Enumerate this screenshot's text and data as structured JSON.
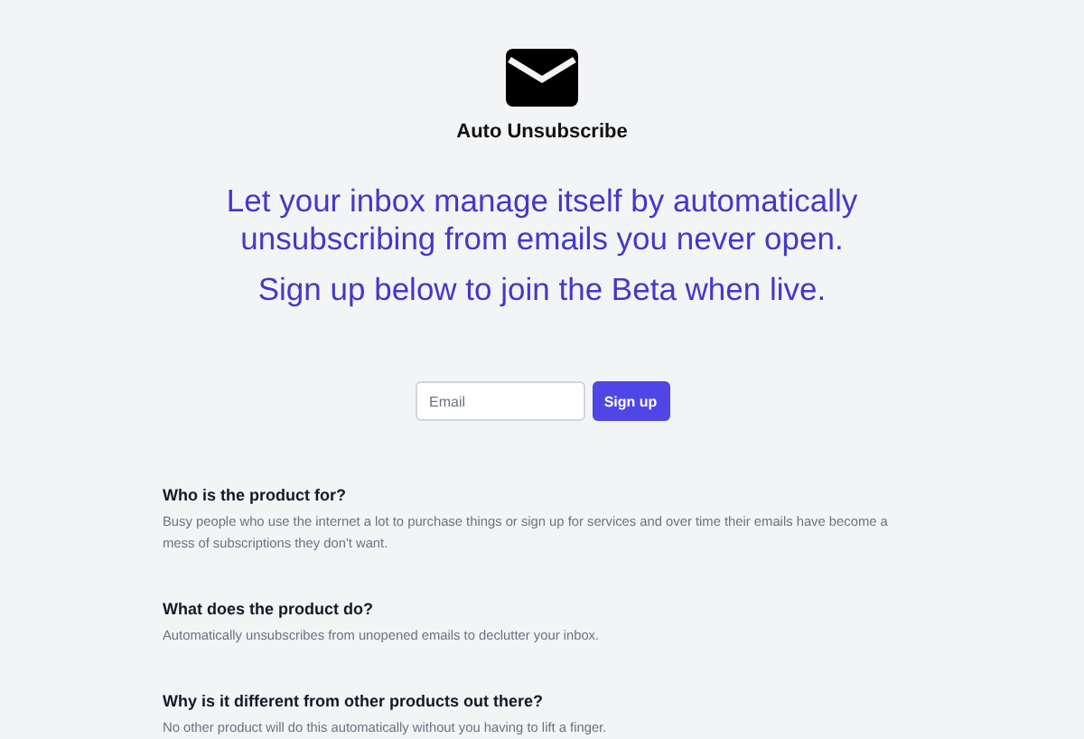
{
  "brand": {
    "name": "Auto Unsubscribe"
  },
  "headline": "Let your inbox manage itself by automatically unsubscribing from emails you never open.",
  "subheadline": "Sign up below to join the Beta when live.",
  "signup": {
    "placeholder": "Email",
    "button": "Sign up"
  },
  "faq": [
    {
      "question": "Who is the product for?",
      "answer": "Busy people who use the internet a lot to purchase things or sign up for services and over time their emails have become a mess of subscriptions they don't want."
    },
    {
      "question": "What does the product do?",
      "answer": "Automatically unsubscribes from unopened emails to declutter your inbox."
    },
    {
      "question": "Why is it different from other products out there?",
      "answer": "No other product will do this automatically without you having to lift a finger."
    }
  ]
}
